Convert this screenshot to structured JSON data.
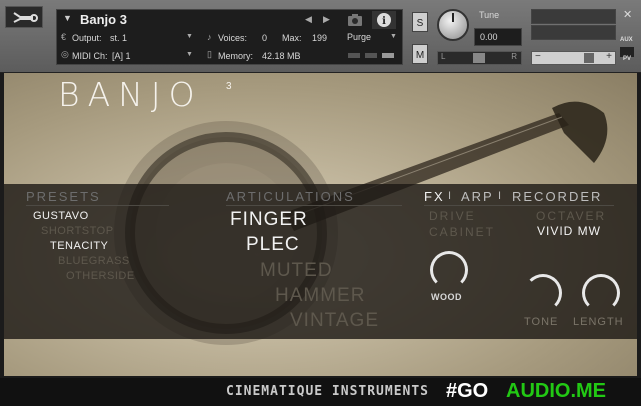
{
  "header": {
    "instrument_name": "Banjo 3",
    "output_label": "Output:",
    "output_value": "st. 1",
    "midi_label": "MIDI Ch:",
    "midi_value": "[A]  1",
    "voices_label": "Voices:",
    "voices_value": "0",
    "max_label": "Max:",
    "max_value": "199",
    "memory_label": "Memory:",
    "memory_value": "42.18 MB",
    "purge_label": "Purge",
    "s_label": "S",
    "m_label": "M",
    "tune_label": "Tune",
    "tune_value": "0.00",
    "pan_left": "L",
    "pan_right": "R",
    "aux_label": "AUX",
    "pv_label": "PV",
    "minus": "−",
    "plus": "+"
  },
  "logo": {
    "text": "BANJO",
    "superscript": "3"
  },
  "presets": {
    "title": "PRESETS",
    "items": [
      {
        "name": "GUSTAVO",
        "active": true
      },
      {
        "name": "SHORTSTOP",
        "active": false
      },
      {
        "name": "TENACITY",
        "active": true
      },
      {
        "name": "BLUEGRASS",
        "active": false
      },
      {
        "name": "OTHERSIDE",
        "active": false
      }
    ]
  },
  "articulations": {
    "title": "ARTICULATIONS",
    "items": [
      {
        "name": "FINGER",
        "active": true
      },
      {
        "name": "PLEC",
        "active": true
      },
      {
        "name": "MUTED",
        "active": false
      },
      {
        "name": "HAMMER",
        "active": false
      },
      {
        "name": "VINTAGE",
        "active": false
      }
    ]
  },
  "fx": {
    "tab_fx": "FX",
    "tab_arp": "ARP",
    "tab_recorder": "RECORDER",
    "separator": "I",
    "drive": "DRIVE",
    "cabinet": "CABINET",
    "octaver": "OCTAVER",
    "vivid": "VIVID MW",
    "wood": "WOOD",
    "tone": "TONE",
    "length": "LENGTH"
  },
  "footer": {
    "brand": "CINEMATIQUE INSTRUMENTS",
    "watermark_hash": "#GO",
    "watermark_rest": "AUDIO.ME"
  },
  "colors": {
    "bg_body": "#b8ad93",
    "band": "#1c1814",
    "active_text": "#f2f2f2",
    "inactive_text": "#5e584d",
    "watermark_green": "#22c814"
  }
}
